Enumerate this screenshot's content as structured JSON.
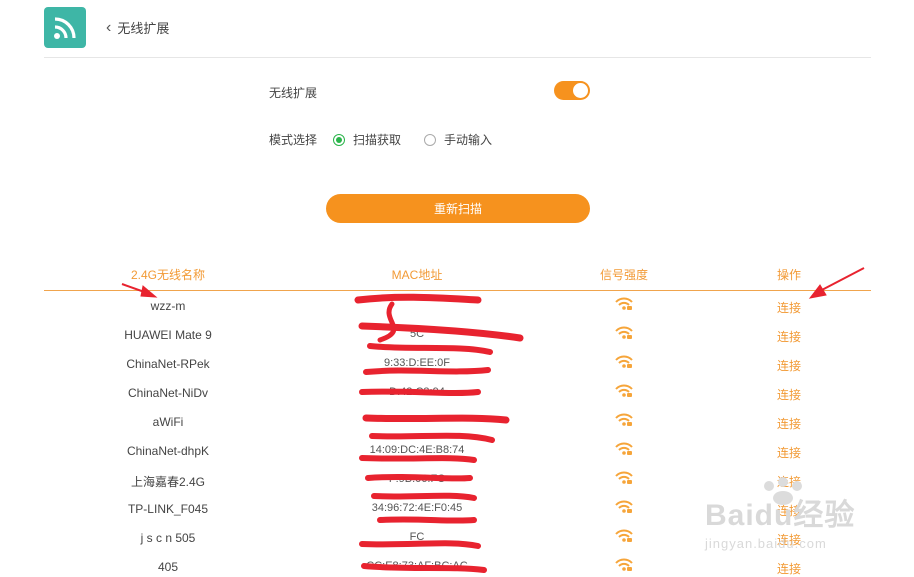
{
  "header": {
    "back_label": "无线扩展"
  },
  "settings": {
    "extend_label": "无线扩展",
    "extend_enabled": true,
    "mode_label": "模式选择",
    "mode_options": [
      "扫描获取",
      "手动输入"
    ],
    "mode_selected": "扫描获取",
    "rescan_label": "重新扫描"
  },
  "table": {
    "headers": [
      "2.4G无线名称",
      "MAC地址",
      "信号强度",
      "操作"
    ],
    "rows": [
      {
        "name": "wzz-m",
        "mac": "",
        "action": "连接"
      },
      {
        "name": "HUAWEI Mate 9",
        "mac": "5C",
        "action": "连接"
      },
      {
        "name": "ChinaNet-RPek",
        "mac": "9:33:D:EE:0F",
        "action": "连接"
      },
      {
        "name": "ChinaNet-NiDv",
        "mac": "D:42:C3:94",
        "action": "连接"
      },
      {
        "name": "aWiFi",
        "mac": "",
        "action": "连接"
      },
      {
        "name": "ChinaNet-dhpK",
        "mac": "14:09:DC:4E:B8:74",
        "action": "连接"
      },
      {
        "name": "上海嘉春2.4G",
        "mac": "F:9B:06:FC",
        "action": "连接"
      },
      {
        "name": "TP-LINK_F045",
        "mac": "34:96:72:4E:F0:45",
        "action": "连接"
      },
      {
        "name": "j s c n 505",
        "mac": "FC",
        "action": "连接"
      },
      {
        "name": "405",
        "mac": "CC:E8:73:AF:BC:AC",
        "action": "连接"
      }
    ]
  },
  "watermark": {
    "brand": "Baidu经验",
    "url": "jingyan.baidu.com"
  },
  "colors": {
    "accent": "#f6921e",
    "logo": "#3eb6a6",
    "radio_on": "#2ab44a",
    "annotation": "#e8232f"
  }
}
